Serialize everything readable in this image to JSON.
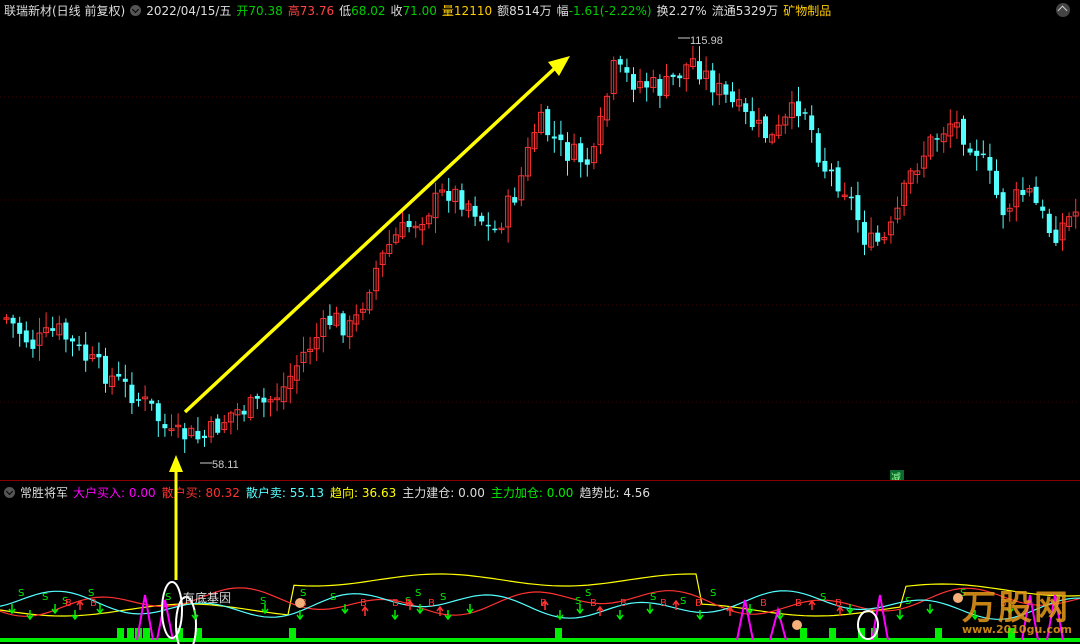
{
  "header": {
    "stock_name": "联瑞新材(日线 前复权)",
    "date": "2022/04/15/五",
    "open_label": "开",
    "open": "70.38",
    "high_label": "高",
    "high": "73.76",
    "low_label": "低",
    "low": "68.02",
    "close_label": "收",
    "close": "71.00",
    "volume_label": "量",
    "volume": "12110",
    "amount_label": "额",
    "amount": "8514万",
    "change_label": "幅",
    "change": "-1.61(-2.22%)",
    "turnover_label": "换",
    "turnover": "2.27%",
    "float_label": "流通",
    "float": "5329万",
    "sector": "矿物制品"
  },
  "price_chart": {
    "max_price_label": "115.98",
    "min_price_label": "58.11",
    "reduce_badge": "减",
    "up_color": "#ff3232",
    "down_color": "#54ffff",
    "arrow_color": "#ffff00"
  },
  "indicator": {
    "name": "常胜将军",
    "items": [
      {
        "label": "大户买入:",
        "value": "0.00",
        "color": "#ff00ff"
      },
      {
        "label": "散户买:",
        "value": "80.32",
        "color": "#ff3232"
      },
      {
        "label": "散户卖:",
        "value": "55.13",
        "color": "#54ffff"
      },
      {
        "label": "趋向:",
        "value": "36.63",
        "color": "#ffff00"
      },
      {
        "label": "主力建仓:",
        "value": "0.00",
        "color": "#dddddd"
      },
      {
        "label": "主力加仓:",
        "value": "0.00",
        "color": "#00ee00"
      },
      {
        "label": "趋势比:",
        "value": "4.56",
        "color": "#dddddd"
      }
    ],
    "annotation": "有底基因"
  },
  "watermark": {
    "brand": "万股网",
    "url": "www.2010gu.com"
  }
}
